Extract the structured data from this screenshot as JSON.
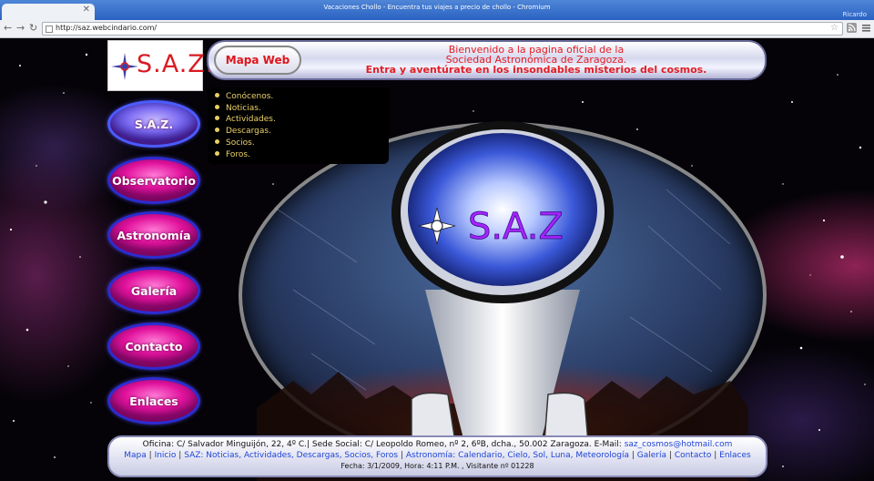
{
  "browser": {
    "window_title": "Vacaciones Chollo - Encuentra tus viajes a precio de chollo - Chromium",
    "user": "Ricardo",
    "url": "http://saz.webcindario.com/"
  },
  "logo": {
    "text": "S.A.Z."
  },
  "header": {
    "map_button": "Mapa Web",
    "welcome_lines": [
      "Bienvenido a la pagina oficial de la",
      "Sociedad Astronómica de Zaragoza.",
      "Entra y aventúrate en los insondables misterios del cosmos."
    ]
  },
  "submenu": {
    "items": [
      "Conócenos.",
      "Noticias.",
      "Actividades.",
      "Descargas.",
      "Socios.",
      "Foros."
    ]
  },
  "nav": {
    "items": [
      "S.A.Z.",
      "Observatorio",
      "Astronomía",
      "Galería",
      "Contacto",
      "Enlaces"
    ]
  },
  "main_image": {
    "overlay_text": "S.A.Z"
  },
  "footer": {
    "address": "Oficina: C/ Salvador Minguijón, 22, 4º C.| Sede Social: C/ Leopoldo Romeo, nº 2, 6ºB, dcha., 50.002 Zaragoza. E-Mail:",
    "email": "saz_cosmos@hotmail.com",
    "links": [
      "Mapa",
      "Inicio",
      "SAZ: Noticias, Actividades, Descargas, Socios, Foros",
      "Astronomía: Calendario, Cielo, Sol, Luna, Meteorología",
      "Galería",
      "Contacto",
      "Enlaces"
    ],
    "status": "Fecha: 3/1/2009, Hora: 4:11 P.M. , Visitante nº 01228"
  },
  "colors": {
    "accent_red": "#e31e24",
    "pill_magenta": "#e2129d",
    "link_blue": "#1f45d6",
    "submenu_text": "#ecd26a"
  }
}
